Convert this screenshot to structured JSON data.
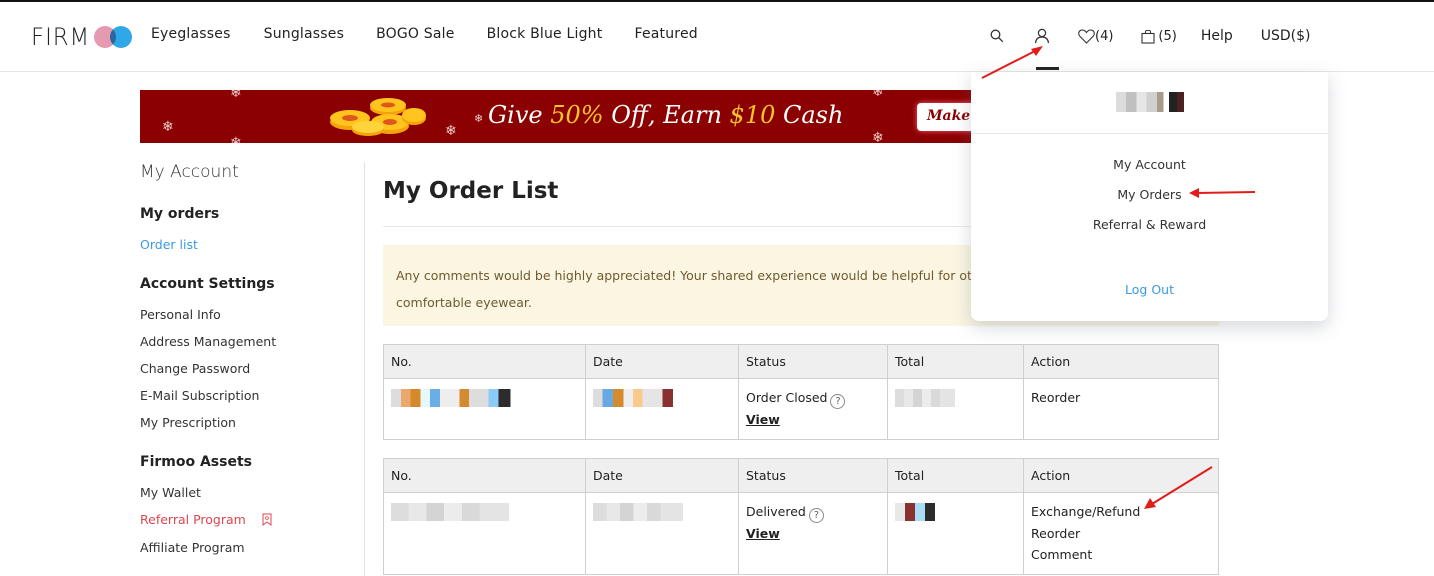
{
  "header": {
    "logo_text": "FIRM",
    "nav": [
      "Eyeglasses",
      "Sunglasses",
      "BOGO Sale",
      "Block Blue Light",
      "Featured"
    ],
    "wishlist_count": "(4)",
    "cart_count": "(5)",
    "help": "Help",
    "currency": "USD($)",
    "icons": [
      "search-icon",
      "user-icon",
      "heart-icon",
      "shopping-bag-icon"
    ]
  },
  "banner": {
    "text_give": "Give ",
    "text_pct": "50%",
    "text_off": " Off, Earn ",
    "text_cash_amt": "$10",
    "text_cash": " Cash",
    "button": "Make ."
  },
  "sidebar": {
    "title": "My Account",
    "sections": [
      {
        "title": "My orders",
        "items": [
          "Order list"
        ]
      },
      {
        "title": "Account Settings",
        "items": [
          "Personal Info",
          "Address Management",
          "Change Password",
          "E-Mail Subscription",
          "My Prescription"
        ]
      },
      {
        "title": "Firmoo Assets",
        "items": [
          "My Wallet",
          "Referral Program",
          "Affiliate Program"
        ]
      }
    ],
    "active_item": "Order list",
    "highlight_item": "Referral Program"
  },
  "main": {
    "title": "My Order List",
    "notice": "Any comments would be highly appreciated! Your shared experience would be helpful for others to find comfortable eyewear.",
    "notice_line1": "Any comments would be highly appreciated! Your shared experience would be helpful for oth",
    "notice_line2": "comfortable eyewear.",
    "columns": [
      "No.",
      "Date",
      "Status",
      "Total",
      "Action"
    ],
    "orders": [
      {
        "no": "",
        "date": "",
        "status": "Order Closed",
        "view": "View",
        "total": "",
        "actions": [
          "Reorder"
        ]
      },
      {
        "no": "",
        "date": "",
        "status": "Delivered",
        "view": "View",
        "total": "",
        "actions": [
          "Exchange/Refund",
          "Reorder",
          "Comment"
        ]
      }
    ]
  },
  "dropdown": {
    "items": [
      "My Account",
      "My Orders",
      "Referral & Reward"
    ],
    "logout": "Log Out"
  },
  "colors": {
    "accent_blue": "#3b9be0",
    "referral_red": "#e0454f",
    "banner_bg": "#8b0000",
    "banner_highlight": "#f7c52b",
    "notice_bg": "#fbf6e2",
    "annotation_arrow": "#e21b1b"
  }
}
